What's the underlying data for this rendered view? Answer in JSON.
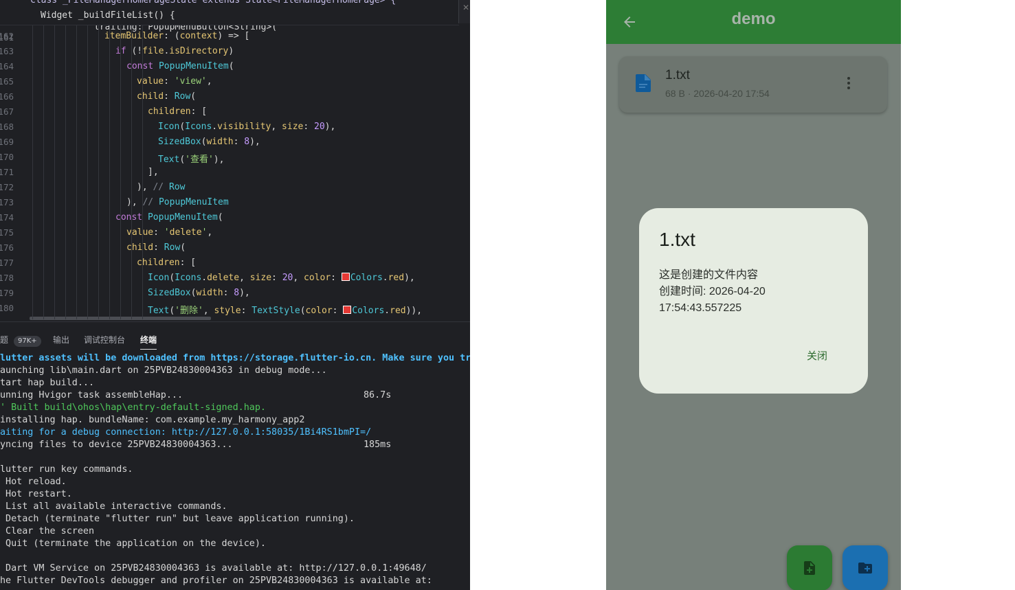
{
  "editor": {
    "sticky_line_1": "class _FileManagerHomePageState extends State<FileManagerHomePage> {",
    "sticky_line_2": "Widget _buildFileList() {",
    "partial_line": "trailing: PopupMenuButton<String>(",
    "lines": [
      {
        "num": "162",
        "text": "itemBuilder: (context) => ["
      },
      {
        "num": "163",
        "text": "if (!file.isDirectory)"
      },
      {
        "num": "164",
        "text": "const PopupMenuItem("
      },
      {
        "num": "165",
        "text": "value: 'view',"
      },
      {
        "num": "166",
        "text": "child: Row("
      },
      {
        "num": "167",
        "text": "children: ["
      },
      {
        "num": "168",
        "text": "Icon(Icons.visibility, size: 20),"
      },
      {
        "num": "169",
        "text": "SizedBox(width: 8),"
      },
      {
        "num": "170",
        "text": "Text('查看'),"
      },
      {
        "num": "171",
        "text": "],"
      },
      {
        "num": "172",
        "text": "), // Row"
      },
      {
        "num": "173",
        "text": "), // PopupMenuItem"
      },
      {
        "num": "174",
        "text": "const PopupMenuItem("
      },
      {
        "num": "175",
        "text": "value: 'delete',"
      },
      {
        "num": "176",
        "text": "child: Row("
      },
      {
        "num": "177",
        "text": "children: ["
      },
      {
        "num": "178",
        "text": "Icon(Icons.delete, size: 20, color: Colors.red),"
      },
      {
        "num": "179",
        "text": "SizedBox(width: 8),"
      },
      {
        "num": "180",
        "text": "Text('删除', style: TextStyle(color: Colors.red)),"
      }
    ]
  },
  "panel": {
    "tabs": [
      "题",
      "输出",
      "调试控制台",
      "终端"
    ],
    "problems_badge": "97K+",
    "active_tab": "终端"
  },
  "terminal": {
    "lines": [
      {
        "text": "lutter assets will be downloaded from https://storage.flutter-io.cn. Make sure you tru",
        "style": "blue bold",
        "right": ""
      },
      {
        "text": "aunching lib\\main.dart on 25PVB24830004363 in debug mode...",
        "style": "",
        "right": ""
      },
      {
        "text": "tart hap build...",
        "style": "",
        "right": ""
      },
      {
        "text": "unning Hvigor task assembleHap...",
        "style": "",
        "right": "86.7s"
      },
      {
        "text": "' Built build\\ohos\\hap\\entry-default-signed.hap.",
        "style": "green",
        "right": ""
      },
      {
        "text": "installing hap. bundleName: com.example.my_harmony_app2",
        "style": "",
        "right": ""
      },
      {
        "text": "aiting for a debug connection: http://127.0.0.1:58035/1Bi4RS1bmPI=/",
        "style": "blue",
        "right": ""
      },
      {
        "text": "yncing files to device 25PVB24830004363...",
        "style": "",
        "right": "185ms"
      },
      {
        "text": "",
        "style": "",
        "right": ""
      },
      {
        "text": "lutter run key commands.",
        "style": "",
        "right": ""
      },
      {
        "text": " Hot reload.",
        "style": "",
        "right": ""
      },
      {
        "text": " Hot restart.",
        "style": "",
        "right": ""
      },
      {
        "text": " List all available interactive commands.",
        "style": "",
        "right": ""
      },
      {
        "text": " Detach (terminate \"flutter run\" but leave application running).",
        "style": "",
        "right": ""
      },
      {
        "text": " Clear the screen",
        "style": "",
        "right": ""
      },
      {
        "text": " Quit (terminate the application on the device).",
        "style": "",
        "right": ""
      },
      {
        "text": "",
        "style": "",
        "right": ""
      },
      {
        "text": " Dart VM Service on 25PVB24830004363 is available at: http://127.0.0.1:49648/",
        "style": "",
        "right": ""
      },
      {
        "text": "he Flutter DevTools debugger and profiler on 25PVB24830004363 is available at:",
        "style": "",
        "right": ""
      }
    ]
  },
  "phone": {
    "app_title": "demo",
    "file": {
      "name": "1.txt",
      "meta": "68 B · 2026-04-20 17:54"
    },
    "dialog": {
      "title": "1.txt",
      "body_lines": [
        "这是创建的文件内容",
        "创建时间: 2026-04-20",
        "17:54:43.557225"
      ],
      "close_label": "关闭"
    },
    "colors": {
      "appbar": "#2d7d35",
      "fab_file": "#2c7b33",
      "fab_folder": "#1b6fb1",
      "dialog": "#e6ece2"
    },
    "icons": [
      "back-arrow-icon",
      "file-icon",
      "more-vert-icon",
      "note-add-icon",
      "create-new-folder-icon"
    ]
  }
}
